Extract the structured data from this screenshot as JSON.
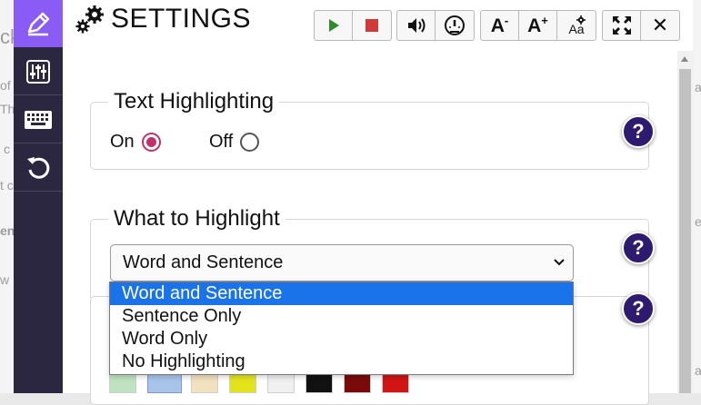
{
  "background_text": {
    "left_lines": [
      "ck",
      "of",
      "Th",
      "c",
      "t c",
      "en",
      "w"
    ],
    "right_lines": [
      "a",
      "e",
      "a"
    ]
  },
  "sidebar": {
    "items": [
      {
        "icon": "pencil-icon",
        "active": true
      },
      {
        "icon": "sliders-icon",
        "active": false
      },
      {
        "icon": "keyboard-icon",
        "active": false
      },
      {
        "icon": "reset-icon",
        "active": false
      }
    ]
  },
  "header": {
    "title": "SETTINGS",
    "icon": "gears-icon"
  },
  "toolbar": {
    "play_icon": "play-icon",
    "stop_icon": "stop-icon",
    "speaker_icon": "speaker-icon",
    "speed_icon": "speedometer-icon",
    "font_decrease_label": "A",
    "font_decrease_sup": "-",
    "font_increase_label": "A",
    "font_increase_sup": "+",
    "font_settings_label": "Aa",
    "expand_icon": "expand-icon",
    "close_label": "✕",
    "colors": {
      "play": "#2e8b2e",
      "stop": "#d03a3a"
    }
  },
  "text_highlighting": {
    "legend": "Text Highlighting",
    "on_label": "On",
    "off_label": "Off",
    "selected": "On",
    "help_label": "?"
  },
  "what_to_highlight": {
    "legend": "What to Highlight",
    "selected_value": "Word and Sentence",
    "options": [
      "Word and Sentence",
      "Sentence Only",
      "Word Only",
      "No Highlighting"
    ],
    "help_label": "?"
  },
  "highlight_color": {
    "help_label": "?",
    "swatches": [
      "#bfe3c0",
      "#a9c4ea",
      "#f1e2bd",
      "#e3e31c",
      "#f0f0f0",
      "#111111",
      "#7a0a0a",
      "#d11414"
    ]
  },
  "colors": {
    "accent": "#8a5cf5",
    "sidebar_bg": "#2b2740",
    "help_bg": "#2e1a6e",
    "radio_checked": "#c2306a",
    "dropdown_selected": "#1a73e8"
  }
}
